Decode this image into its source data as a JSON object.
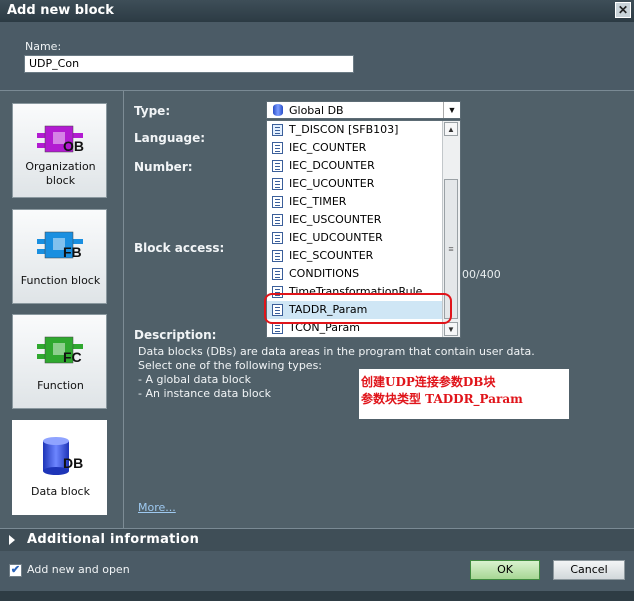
{
  "window": {
    "title": "Add new block",
    "close_glyph": "✕"
  },
  "name": {
    "label": "Name:",
    "value": "UDP_Con"
  },
  "blocks": [
    {
      "id": "ob",
      "badge": "OB",
      "label_lines": [
        "Organization",
        "block"
      ],
      "color": "#b21bd1",
      "icon": "ob-block-icon"
    },
    {
      "id": "fb",
      "badge": "FB",
      "label_lines": [
        "Function block"
      ],
      "color": "#1a8fe0",
      "icon": "fb-block-icon"
    },
    {
      "id": "fc",
      "badge": "FC",
      "label_lines": [
        "Function"
      ],
      "color": "#2fa82f",
      "icon": "fc-block-icon"
    },
    {
      "id": "db",
      "badge": "DB",
      "label_lines": [
        "Data block"
      ],
      "color": "#2b47d8",
      "icon": "db-block-icon",
      "selected": true
    }
  ],
  "fields": {
    "type_label": "Type:",
    "language_label": "Language:",
    "number_label": "Number:",
    "block_access_label": "Block access:",
    "description_label": "Description:"
  },
  "type_select": {
    "value": "Global DB",
    "arrow": "▼"
  },
  "dropdown": {
    "items": [
      {
        "text": "T_DISCON  [SFB103]",
        "icon": "fb-icon"
      },
      {
        "text": "IEC_COUNTER",
        "icon": "db-icon"
      },
      {
        "text": "IEC_DCOUNTER",
        "icon": "db-icon"
      },
      {
        "text": "IEC_UCOUNTER",
        "icon": "db-icon"
      },
      {
        "text": "IEC_TIMER",
        "icon": "db-icon"
      },
      {
        "text": "IEC_USCOUNTER",
        "icon": "db-icon"
      },
      {
        "text": "IEC_UDCOUNTER",
        "icon": "db-icon"
      },
      {
        "text": "IEC_SCOUNTER",
        "icon": "db-icon"
      },
      {
        "text": "CONDITIONS",
        "icon": "db-icon"
      },
      {
        "text": "TimeTransformationRule",
        "icon": "db-icon"
      },
      {
        "text": "TADDR_Param",
        "icon": "db-icon",
        "selected": true
      },
      {
        "text": "TCON_Param",
        "icon": "db-icon"
      }
    ],
    "scroll_up": "▲",
    "scroll_down": "▼",
    "thumb_grip": "≡"
  },
  "right_fragment": "00/400",
  "description": {
    "lines": [
      "Data blocks (DBs) are data areas in the program that contain user data.",
      "Select one of the following types:",
      "- A global data block",
      "- An instance data block"
    ]
  },
  "annotation": {
    "line1": "创建UDP连接参数DB块",
    "line2": "参数块类型  TADDR_Param"
  },
  "more_link": "More...",
  "additional": {
    "label": "Additional  information"
  },
  "footer": {
    "checkbox_label": "Add new and open",
    "checkbox_checked": true,
    "check_glyph": "✔",
    "ok_label": "OK",
    "cancel_label": "Cancel"
  }
}
